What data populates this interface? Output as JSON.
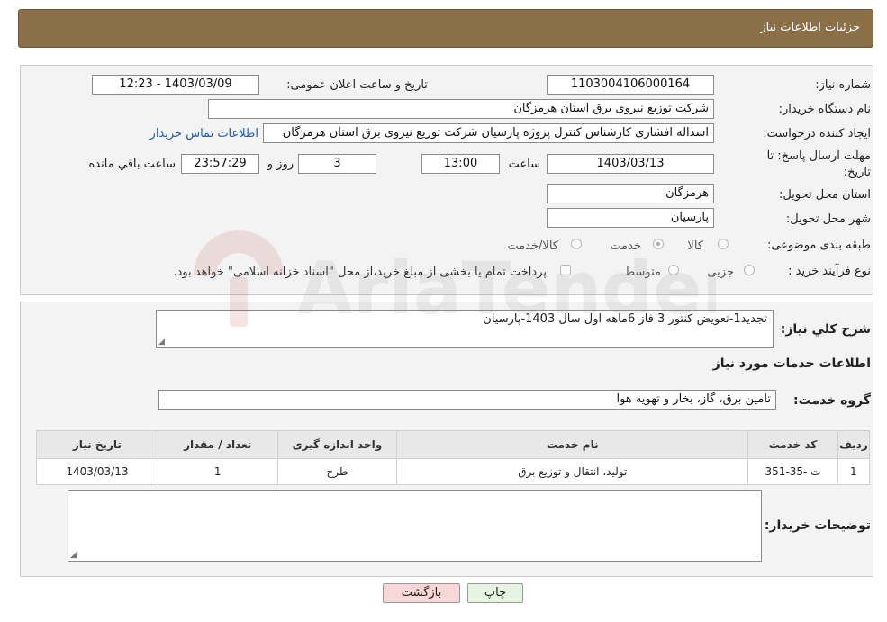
{
  "header": {
    "title": "جزئیات اطلاعات نیاز"
  },
  "form": {
    "need_number_label": "شماره نیاز:",
    "need_number": "1103004106000164",
    "announce_label": "تاریخ و ساعت اعلان عمومی:",
    "announce_value": "1403/03/09 - 12:23",
    "buyer_org_label": "نام دستگاه خریدار:",
    "buyer_org": "شرکت توزیع نیروی برق استان هرمزگان",
    "creator_label": "ایجاد کننده درخواست:",
    "creator": "اسداله افشاری کارشناس کنترل پروژه پارسیان شرکت توزیع نیروی برق استان هرمزگان",
    "contact_link": "اطلاعات تماس خریدار",
    "deadline_label_1": "مهلت ارسال پاسخ: تا",
    "deadline_label_2": "تاریخ:",
    "deadline_date": "1403/03/13",
    "time_label": "ساعت",
    "deadline_time": "13:00",
    "days_value": "3",
    "days_label": "روز و",
    "remaining_value": "23:57:29",
    "remaining_label": "ساعت باقي مانده",
    "province_label": "استان محل تحویل:",
    "province": "هرمزگان",
    "city_label": "شهر محل تحویل:",
    "city": "پارسیان",
    "category_label": "طبقه بندی موضوعی:",
    "category_options": [
      "کالا",
      "خدمت",
      "کالا/خدمت"
    ],
    "category_selected": "خدمت",
    "purchase_type_label": "نوع فرآیند خرید :",
    "purchase_options": [
      "جزیی",
      "متوسط"
    ],
    "purchase_note": "پرداخت تمام یا بخشی از مبلغ خرید،از محل \"اسناد خزانه اسلامی\" خواهد بود."
  },
  "details": {
    "summary_label": "شرح کلي نياز:",
    "summary": "تجدید1-تعویض کنتور 3 فاز 6ماهه اول سال 1403-پارسیان",
    "services_title": "اطلاعات خدمات مورد نياز",
    "service_group_label": "گروه خدمت:",
    "service_group": "تامین برق، گاز، بخار و تهویه هوا",
    "table": {
      "headers": [
        "ردیف",
        "کد خدمت",
        "نام خدمت",
        "واحد اندازه گیری",
        "تعداد / مقدار",
        "تاریخ نیاز"
      ],
      "rows": [
        [
          "1",
          "ت -35-351",
          "تولید، انتقال و توزیع برق",
          "طرح",
          "1",
          "1403/03/13"
        ]
      ]
    },
    "buyer_notes_label": "توضیحات خریدار:",
    "buyer_notes": ""
  },
  "buttons": {
    "print": "چاپ",
    "back": "بازگشت"
  },
  "colors": {
    "header_bg": "#8b6f47",
    "link": "#1a5fb4",
    "back_btn": "#f8d7d7",
    "print_btn": "#e6f5e1"
  }
}
